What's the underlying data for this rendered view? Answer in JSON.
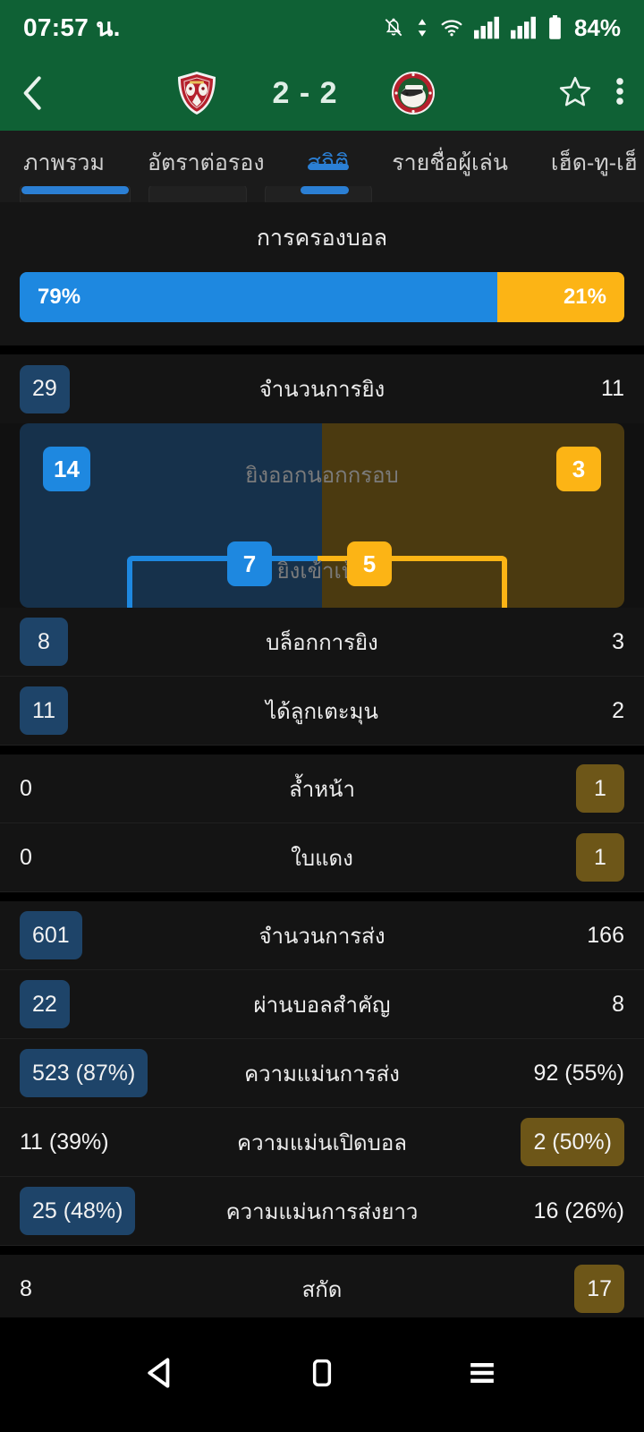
{
  "status_bar": {
    "time": "07:57 น.",
    "battery": "84%",
    "icons": [
      "bell-muted-icon",
      "data-transfer-icon",
      "wifi-icon",
      "signal-sim1-icon",
      "signal-sim2-icon",
      "battery-icon"
    ]
  },
  "app_bar": {
    "back_icon": "back-chevron-icon",
    "home_crest": "home-team-crest",
    "away_crest": "away-team-crest",
    "score": "2 - 2",
    "favorite_icon": "star-outline-icon",
    "overflow_icon": "more-vertical-icon"
  },
  "tabs": {
    "items": [
      {
        "label": "ภาพรวม",
        "active": false
      },
      {
        "label": "อัตราต่อรอง",
        "active": false
      },
      {
        "label": "สถิติ",
        "active": true
      },
      {
        "label": "รายชื่อผู้เล่น",
        "active": false
      },
      {
        "label": "เฮ็ด-ทู-เฮ็",
        "active": false
      }
    ]
  },
  "possession": {
    "title": "การครองบอล",
    "home_value": "79%",
    "away_value": "21%",
    "home_pct": 79,
    "away_pct": 21,
    "home_color": "#1e88e0",
    "away_color": "#fcb415"
  },
  "shots_header": {
    "home": "29",
    "label": "จำนวนการยิง",
    "away": "11",
    "home_highlight": true,
    "away_highlight": false
  },
  "shots_card": {
    "off_target": {
      "home": "14",
      "label": "ยิงออกนอกกรอบ",
      "away": "3"
    },
    "on_target": {
      "home": "7",
      "label": "ยิงเข้าเป้า",
      "away": "5"
    }
  },
  "stat_rows": [
    {
      "home": "8",
      "label": "บล็อกการยิง",
      "away": "3",
      "home_badge": "blue",
      "away_badge": "none"
    },
    {
      "home": "11",
      "label": "ได้ลูกเตะมุน",
      "away": "2",
      "home_badge": "blue",
      "away_badge": "none"
    },
    {
      "home": "0",
      "label": "ล้ำหน้า",
      "away": "1",
      "home_badge": "none",
      "away_badge": "gold"
    },
    {
      "home": "0",
      "label": "ใบแดง",
      "away": "1",
      "home_badge": "none",
      "away_badge": "gold"
    },
    {
      "home": "601",
      "label": "จำนวนการส่ง",
      "away": "166",
      "home_badge": "blue",
      "away_badge": "none"
    },
    {
      "home": "22",
      "label": "ผ่านบอลสำคัญ",
      "away": "8",
      "home_badge": "blue",
      "away_badge": "none"
    },
    {
      "home": "523 (87%)",
      "label": "ความแม่นการส่ง",
      "away": "92 (55%)",
      "home_badge": "blue",
      "away_badge": "none"
    },
    {
      "home": "11 (39%)",
      "label": "ความแม่นเปิดบอล",
      "away": "2 (50%)",
      "home_badge": "none",
      "away_badge": "gold"
    },
    {
      "home": "25 (48%)",
      "label": "ความแม่นการส่งยาว",
      "away": "16 (26%)",
      "home_badge": "blue",
      "away_badge": "none"
    },
    {
      "home": "8",
      "label": "สกัด",
      "away": "17",
      "home_badge": "none",
      "away_badge": "gold"
    }
  ],
  "nav_bar": {
    "back": "nav-back-icon",
    "home": "nav-home-icon",
    "recents": "nav-recents-icon"
  },
  "colors": {
    "header_green": "#0f6135",
    "accent_blue": "#1e88e0",
    "accent_gold": "#fcb415",
    "badge_blue": "#1e4469",
    "badge_gold": "#6d5618",
    "panel_dark": "#141414"
  }
}
